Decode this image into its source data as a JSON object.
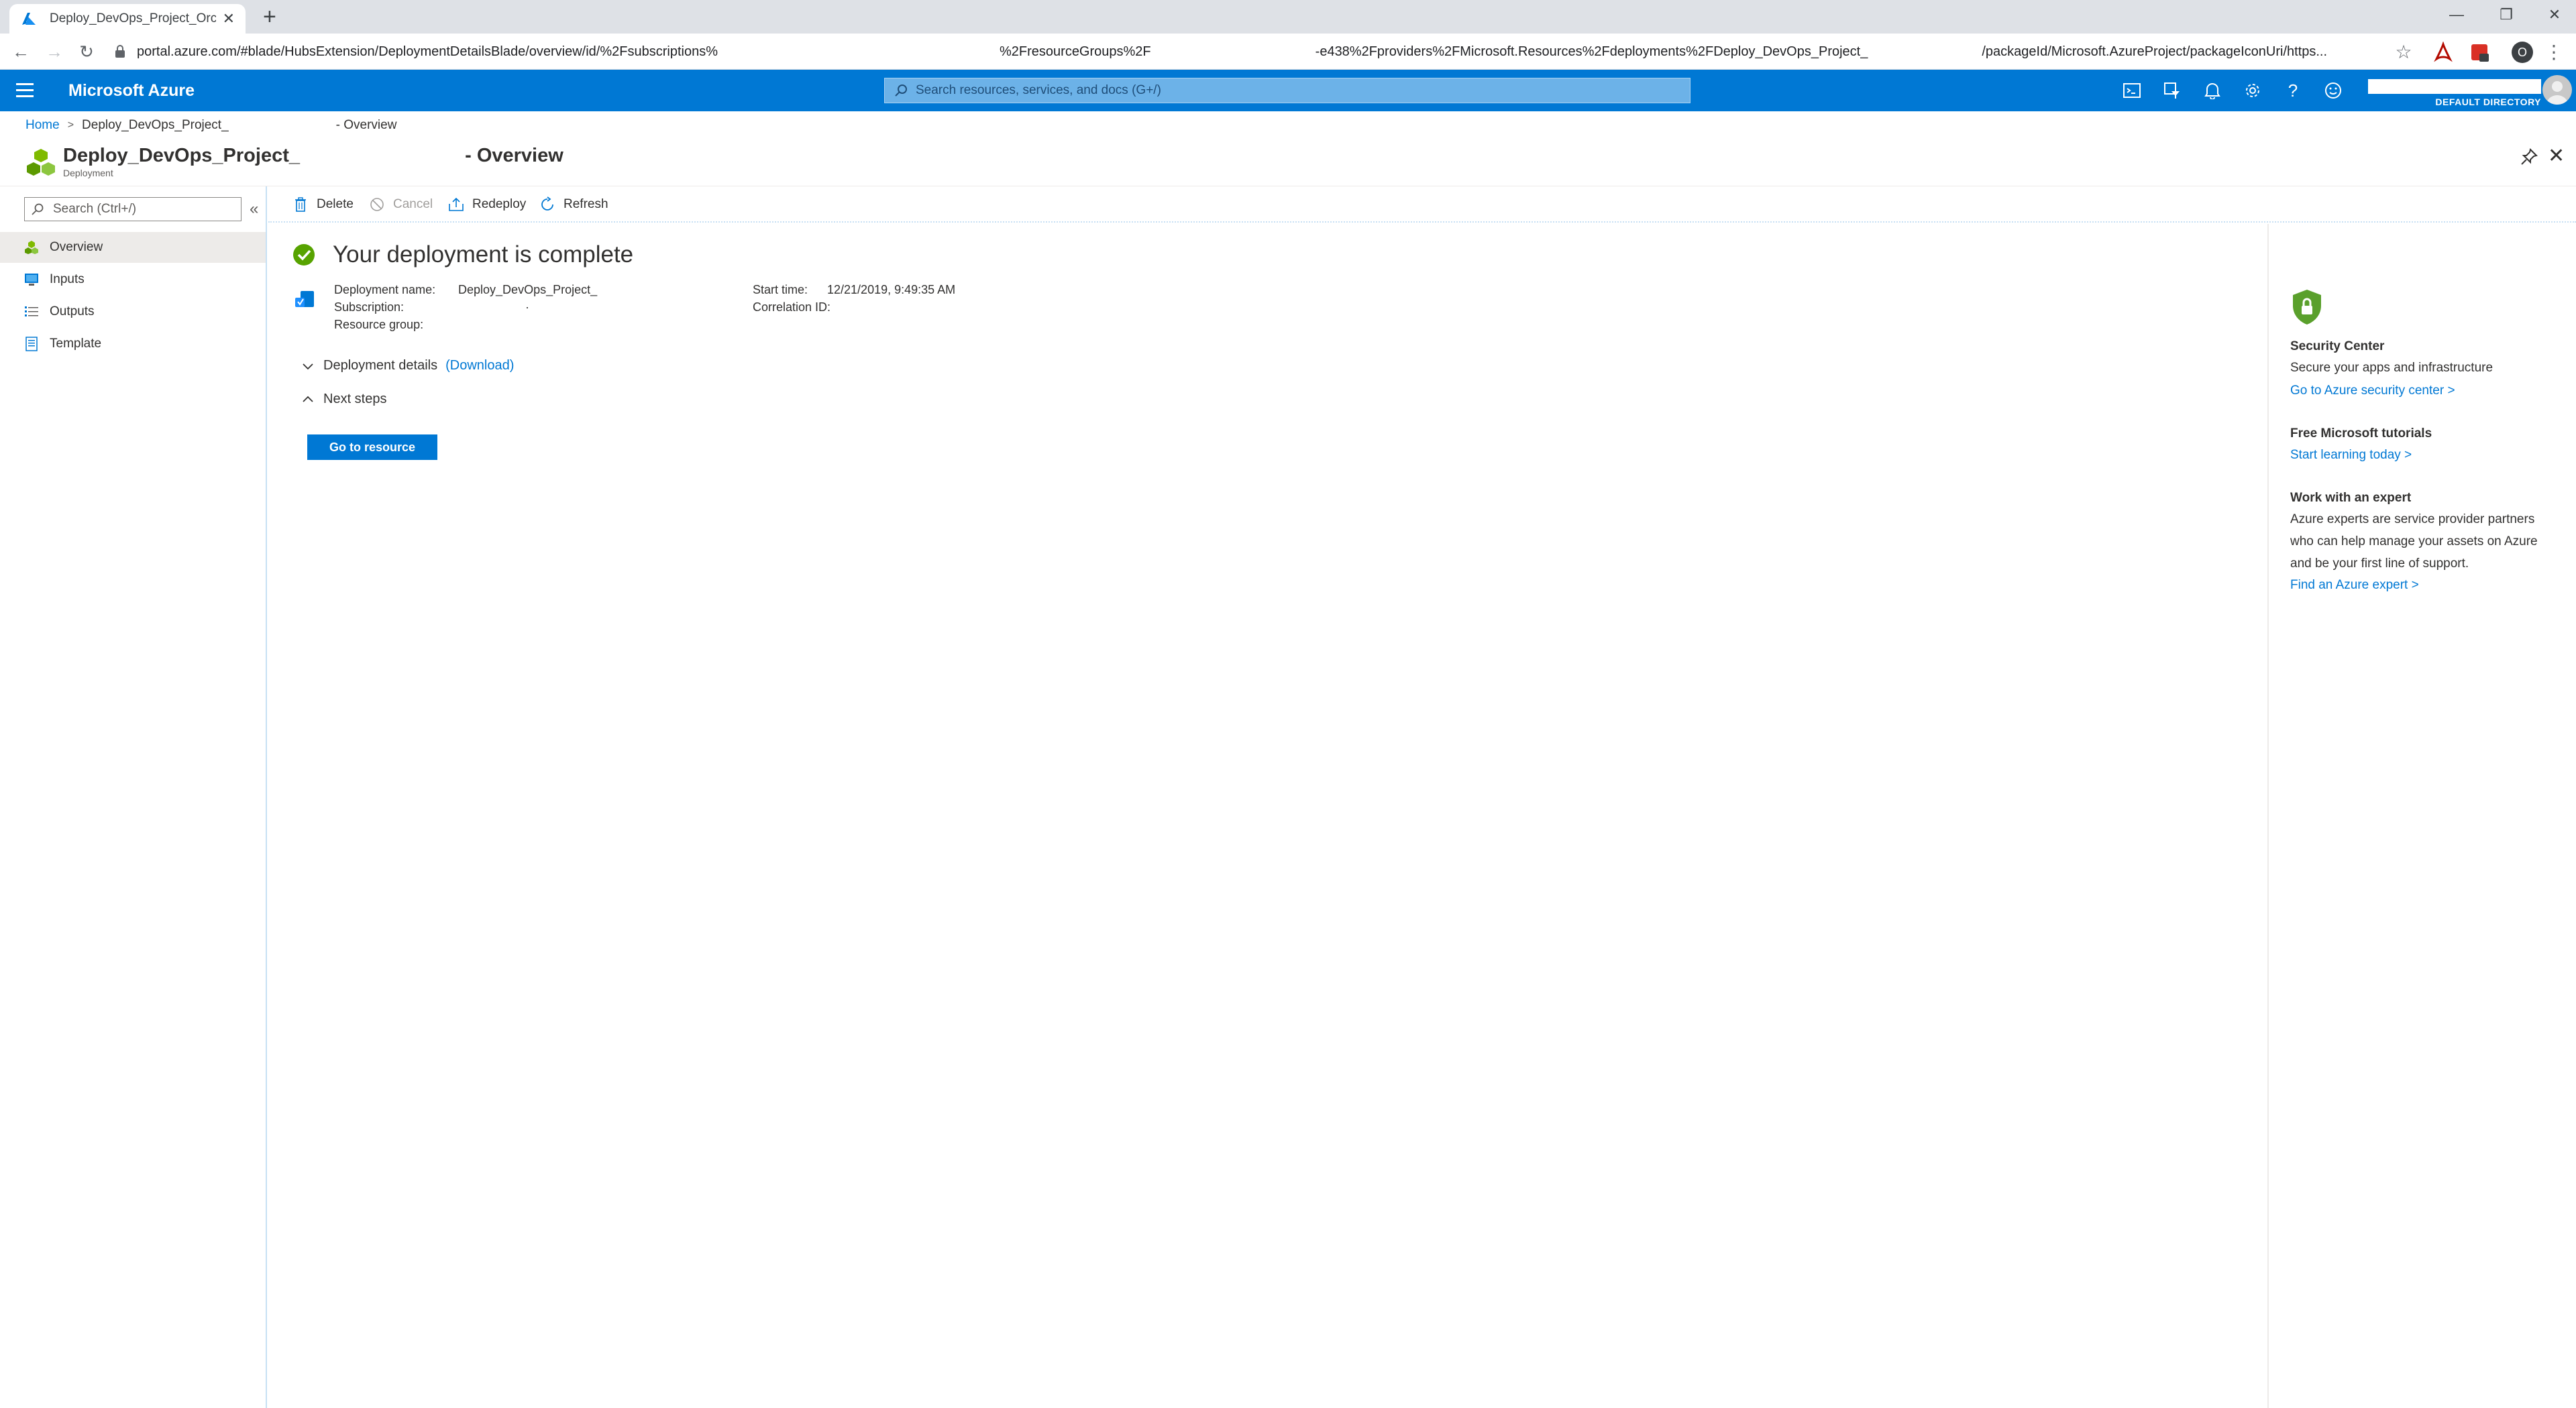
{
  "browser": {
    "tab_title": "Deploy_DevOps_Project_Orchard",
    "tab_close": "✕",
    "new_tab": "+",
    "window_controls": [
      "—",
      "❐",
      "✕"
    ],
    "url_parts": [
      "portal.azure.com/#blade/HubsExtension/DeploymentDetailsBlade/overview/id/%2Fsubscriptions%",
      "%2FresourceGroups%2F",
      "-e438%2Fproviders%2FMicrosoft.Resources%2Fdeployments%2FDeploy_DevOps_Project_",
      "/packageId/Microsoft.AzureProject/packageIconUri/https..."
    ]
  },
  "azure": {
    "brand": "Microsoft Azure",
    "search_placeholder": "Search resources, services, and docs (G+/)",
    "directory": "DEFAULT DIRECTORY"
  },
  "breadcrumb": {
    "home": "Home",
    "separator": ">",
    "deployment": "Deploy_DevOps_Project_",
    "suffix": "- Overview"
  },
  "blade": {
    "title": "Deploy_DevOps_Project_",
    "title_suffix": "- Overview",
    "subtitle": "Deployment"
  },
  "leftnav": {
    "search_placeholder": "Search (Ctrl+/)",
    "collapse": "«",
    "items": [
      {
        "label": "Overview"
      },
      {
        "label": "Inputs"
      },
      {
        "label": "Outputs"
      },
      {
        "label": "Template"
      }
    ]
  },
  "toolbar": {
    "delete": "Delete",
    "cancel": "Cancel",
    "redeploy": "Redeploy",
    "refresh": "Refresh"
  },
  "main": {
    "status": "Your deployment is complete",
    "deployment_name_label": "Deployment name:",
    "deployment_name_value": "Deploy_DevOps_Project_",
    "subscription_label": "Subscription:",
    "subscription_value": "·",
    "resource_group_label": "Resource group:",
    "start_time_label": "Start time:",
    "start_time_value": "12/21/2019, 9:49:35 AM",
    "correlation_label": "Correlation ID:",
    "deployment_details": "Deployment details",
    "download": "(Download)",
    "next_steps": "Next steps",
    "go_to_resource": "Go to resource"
  },
  "rightpanel": {
    "security_title": "Security Center",
    "security_text": "Secure your apps and infrastructure",
    "security_link": "Go to Azure security center >",
    "tutorials_title": "Free Microsoft tutorials",
    "tutorials_link": "Start learning today >",
    "expert_title": "Work with an expert",
    "expert_text": "Azure experts are service provider partners who can help manage your assets on Azure and be your first line of support.",
    "expert_link": "Find an Azure expert >"
  },
  "colors": {
    "azure_blue": "#0078d4",
    "success_green": "#57a300",
    "shield_green": "#5aa02c"
  }
}
